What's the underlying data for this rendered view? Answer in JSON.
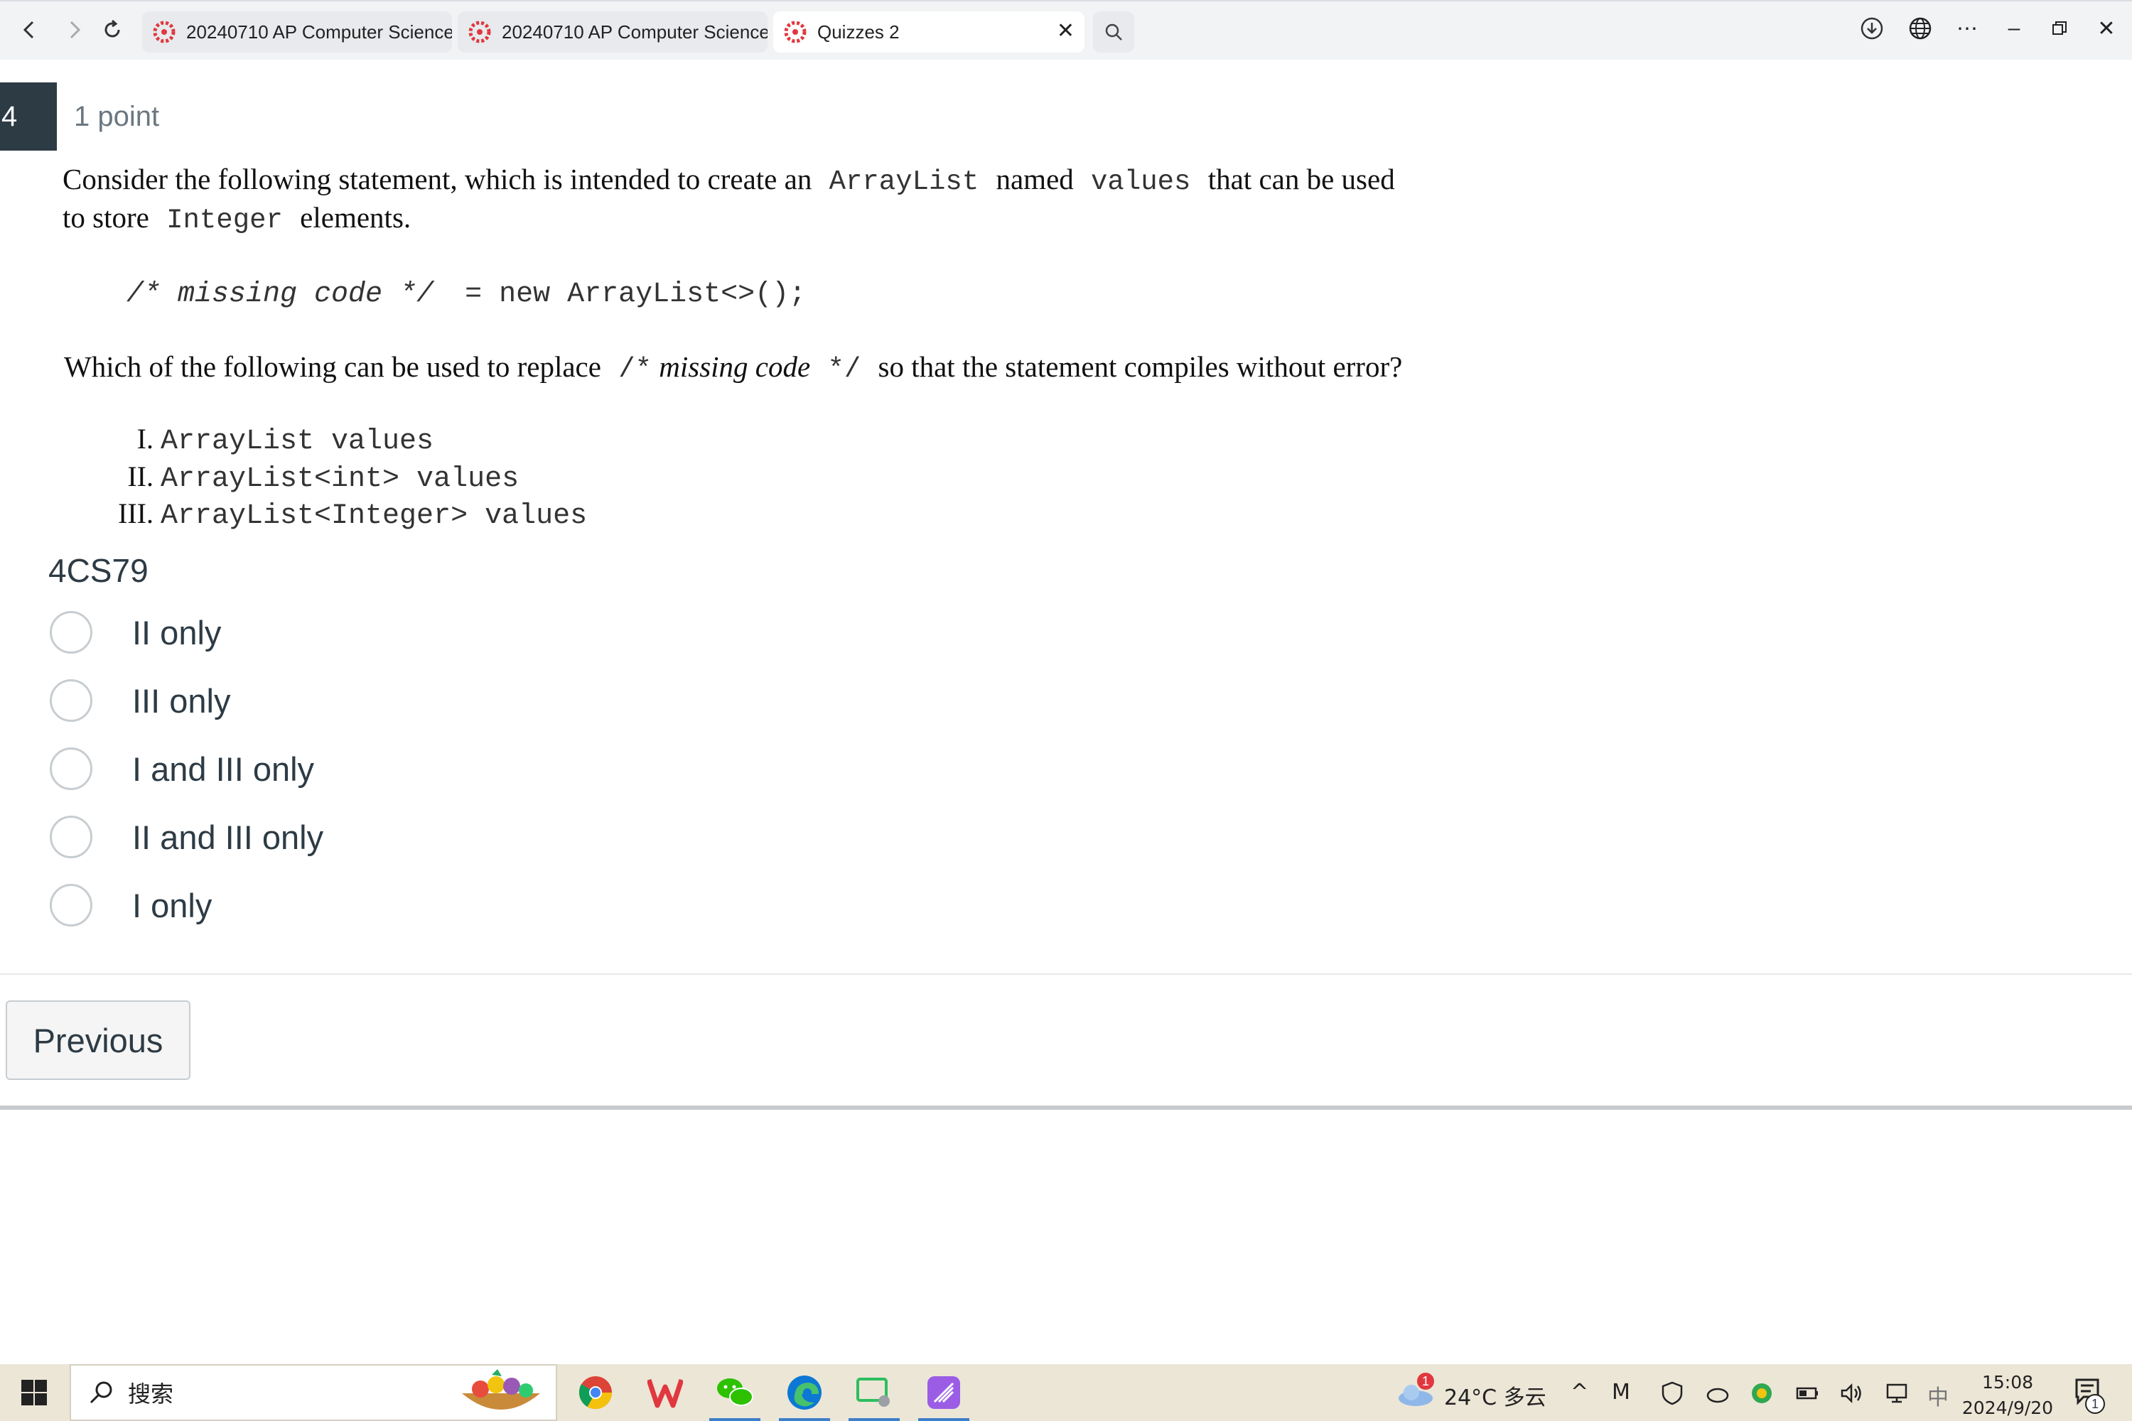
{
  "browser": {
    "tabs": [
      {
        "title": "20240710 AP Computer Science",
        "active": false
      },
      {
        "title": "20240710 AP Computer Science",
        "active": false
      },
      {
        "title": "Quizzes 2",
        "active": true
      }
    ],
    "icons": [
      "back-icon",
      "forward-icon",
      "refresh-icon",
      "search-icon",
      "download-icon",
      "globe-icon",
      "more-icon",
      "minimize-icon",
      "restore-icon",
      "close-icon"
    ]
  },
  "question": {
    "number": "4",
    "points": "1 point",
    "stem": {
      "line1_a": "Consider the following statement, which is intended to create an",
      "line1_code1": "ArrayList",
      "line1_b": "named",
      "line1_code2": "values",
      "line1_c": "that can be used",
      "line2_a": "to store",
      "line2_code": "Integer",
      "line2_b": "elements.",
      "code_statement_comment": "/* missing code */",
      "code_statement_rest": "= new ArrayList<>();",
      "prompt_a": "Which of the following can be used to replace",
      "prompt_code_open": "/*",
      "prompt_italic": "missing code",
      "prompt_code_close": "*/",
      "prompt_b": "so that the statement compiles without error?"
    },
    "choices_roman": [
      {
        "numeral": "I.",
        "code": "ArrayList values"
      },
      {
        "numeral": "II.",
        "code": "ArrayList<int> values"
      },
      {
        "numeral": "III.",
        "code": "ArrayList<Integer> values"
      }
    ],
    "code_id": "4CS79",
    "options": [
      "II only",
      "III only",
      "I and III only",
      "II and III only",
      "I only"
    ]
  },
  "footer": {
    "previous_label": "Previous"
  },
  "taskbar": {
    "search_placeholder": "搜索",
    "weather": "24°C 多云",
    "weather_badge": "1",
    "ime": "中",
    "time": "15:08",
    "date": "2024/9/20",
    "notification_count": "1"
  },
  "colors": {
    "question_badge": "#2d3b45",
    "text": "#2d3b45",
    "tab_icon": "#e0383e",
    "taskbar": "#ece6d7"
  }
}
